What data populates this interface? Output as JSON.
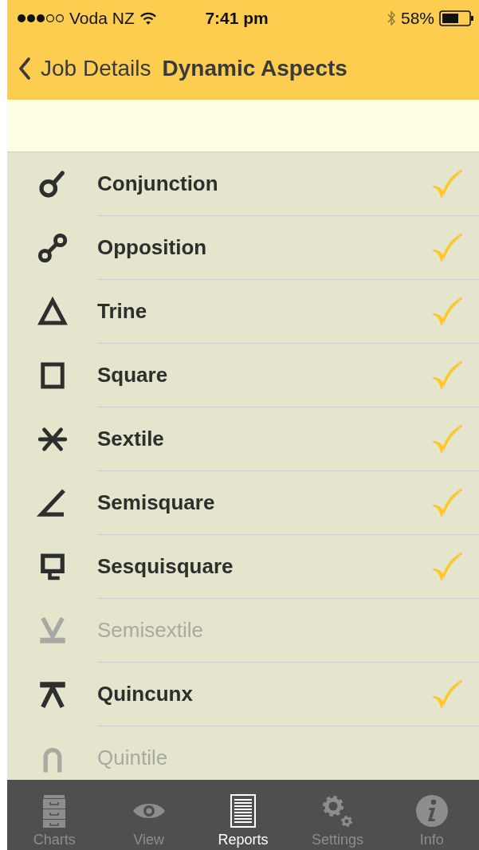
{
  "status_bar": {
    "carrier": "Voda NZ",
    "time": "7:41 pm",
    "battery": "58%"
  },
  "nav_bar": {
    "back": "Job Details",
    "title": "Dynamic Aspects"
  },
  "rows": [
    {
      "kind": "conjunction",
      "label": "Conjunction",
      "checked": true,
      "disabled": false
    },
    {
      "kind": "opposition",
      "label": "Opposition",
      "checked": true,
      "disabled": false
    },
    {
      "kind": "trine",
      "label": "Trine",
      "checked": true,
      "disabled": false
    },
    {
      "kind": "square",
      "label": "Square",
      "checked": true,
      "disabled": false
    },
    {
      "kind": "sextile",
      "label": "Sextile",
      "checked": true,
      "disabled": false
    },
    {
      "kind": "semisquare",
      "label": "Semisquare",
      "checked": true,
      "disabled": false
    },
    {
      "kind": "sesquisquare",
      "label": "Sesquisquare",
      "checked": true,
      "disabled": false
    },
    {
      "kind": "semisextile",
      "label": "Semisextile",
      "checked": false,
      "disabled": true
    },
    {
      "kind": "quincunx",
      "label": "Quincunx",
      "checked": true,
      "disabled": false
    },
    {
      "kind": "quintile",
      "label": "Quintile",
      "checked": false,
      "disabled": true
    }
  ],
  "tabs": [
    {
      "kind": "charts",
      "label": "Charts",
      "selected": false
    },
    {
      "kind": "view",
      "label": "View",
      "selected": false
    },
    {
      "kind": "reports",
      "label": "Reports",
      "selected": true
    },
    {
      "kind": "settings",
      "label": "Settings",
      "selected": false
    },
    {
      "kind": "info",
      "label": "Info",
      "selected": false
    }
  ]
}
